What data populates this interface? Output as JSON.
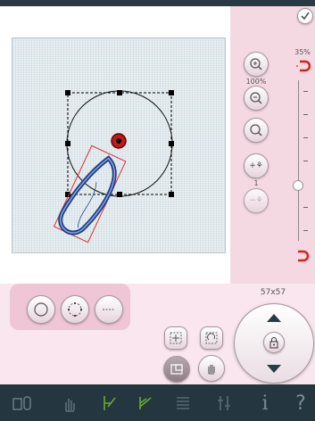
{
  "zoom": {
    "canvas_percent": "35%",
    "zoom_percent": "100%"
  },
  "stitch_count": "1",
  "size_label": "57x57",
  "colors": {
    "accent": "#d62020",
    "panel": "#f4d9e3",
    "bar": "#24363f"
  },
  "icons": {
    "confirm": "check-icon",
    "zoom_in": "zoom-in-icon",
    "zoom_out": "zoom-out-icon",
    "zoom_fit": "zoom-fit-icon",
    "add_stitch": "plus-stitch-icon",
    "remove_stitch": "minus-stitch-icon",
    "magnet_top": "magnet-icon",
    "magnet_bottom": "magnet-icon",
    "shape_circle": "circle-shape-icon",
    "shape_points": "point-circle-icon",
    "shape_line": "line-shape-icon",
    "move_center": "center-icon",
    "rotate": "rotate-icon",
    "resize": "resize-icon",
    "pan": "hand-icon",
    "lock": "lock-icon",
    "up": "arrow-up-icon",
    "down": "arrow-down-icon"
  },
  "bottom_bar": {
    "info_label": "i",
    "help_label": "?"
  }
}
